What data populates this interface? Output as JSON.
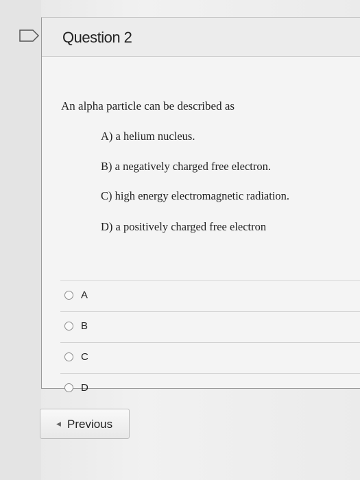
{
  "question": {
    "title": "Question 2",
    "prompt": "An alpha particle can be described as",
    "choices": [
      "A) a helium nucleus.",
      "B) a negatively charged free electron.",
      "C) high energy electromagnetic radiation.",
      "D) a positively charged free electron"
    ],
    "answers": [
      {
        "label": "A",
        "selected": false
      },
      {
        "label": "B",
        "selected": false
      },
      {
        "label": "C",
        "selected": false
      },
      {
        "label": "D",
        "selected": false
      }
    ]
  },
  "navigation": {
    "previous_label": "Previous"
  },
  "icons": {
    "flag": "flag-icon",
    "previous": "chevron-left-icon",
    "radio": "radio-icon"
  },
  "colors": {
    "background": "#efefef",
    "card": "#f4f4f4",
    "text": "#1d1d1d",
    "border": "#9a9a9a"
  }
}
